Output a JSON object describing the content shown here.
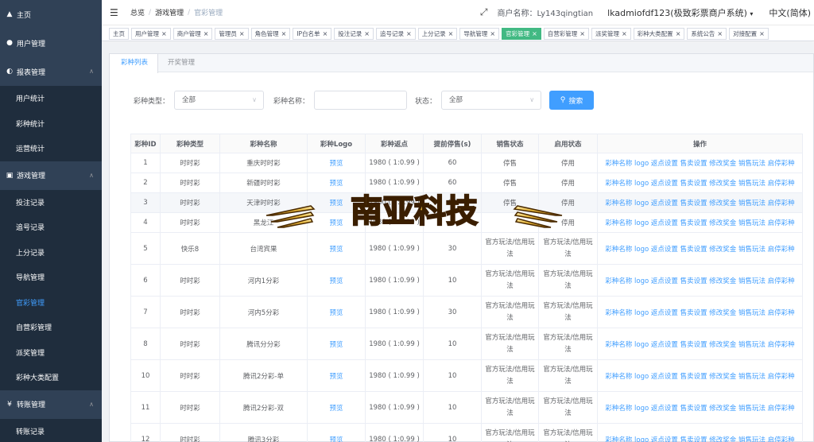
{
  "sidebar": {
    "groups": [
      {
        "label": "主页",
        "icon": "dashboard-icon",
        "glyph": "▲",
        "sub": []
      },
      {
        "label": "用户管理",
        "icon": "user-icon",
        "glyph": "●",
        "sub": []
      },
      {
        "label": "报表管理",
        "icon": "chart-icon",
        "glyph": "◐",
        "sub": [
          "用户统计",
          "彩种统计",
          "运营统计"
        ]
      },
      {
        "label": "游戏管理",
        "icon": "game-icon",
        "glyph": "▣",
        "sub": [
          "投注记录",
          "追号记录",
          "上分记录",
          "导航管理",
          "官彩管理",
          "自营彩管理",
          "派奖管理",
          "彩种大类配置"
        ]
      },
      {
        "label": "转账管理",
        "icon": "yen-icon",
        "glyph": "¥",
        "sub": [
          "转账记录"
        ]
      }
    ],
    "active_sub": "官彩管理"
  },
  "header": {
    "breadcrumb": [
      "总览",
      "游戏管理",
      "官彩管理"
    ],
    "merchant": "商户名称：Ly143qingtian",
    "account": "lkadmiofdf123(极致彩票商户系统)",
    "language": "中文(简体)"
  },
  "tags": [
    {
      "label": "主页",
      "closable": false,
      "active": false
    },
    {
      "label": "用户管理",
      "closable": true,
      "active": false
    },
    {
      "label": "商户管理",
      "closable": true,
      "active": false
    },
    {
      "label": "管理员",
      "closable": true,
      "active": false
    },
    {
      "label": "角色管理",
      "closable": true,
      "active": false
    },
    {
      "label": "IP白名单",
      "closable": true,
      "active": false
    },
    {
      "label": "投注记录",
      "closable": true,
      "active": false
    },
    {
      "label": "追号记录",
      "closable": true,
      "active": false
    },
    {
      "label": "上分记录",
      "closable": true,
      "active": false
    },
    {
      "label": "导航管理",
      "closable": true,
      "active": false
    },
    {
      "label": "官彩管理",
      "closable": true,
      "active": true
    },
    {
      "label": "自营彩管理",
      "closable": true,
      "active": false
    },
    {
      "label": "派奖管理",
      "closable": true,
      "active": false
    },
    {
      "label": "彩种大类配置",
      "closable": true,
      "active": false
    },
    {
      "label": "系统公告",
      "closable": true,
      "active": false
    },
    {
      "label": "对接配置",
      "closable": true,
      "active": false
    }
  ],
  "tabs": [
    "彩种列表",
    "开奖管理"
  ],
  "filters": {
    "type_label": "彩种类型：",
    "type_value": "全部",
    "name_label": "彩种名称：",
    "name_value": "",
    "status_label": "状态：",
    "status_value": "全部",
    "search_label": "搜索"
  },
  "table": {
    "columns": [
      "彩种ID",
      "彩种类型",
      "彩种名称",
      "彩种Logo",
      "彩种返点",
      "提前停售(s)",
      "销售状态",
      "启用状态",
      "操作"
    ],
    "actions": "彩种名称 logo 返点设置 售卖设置 修改奖金 销售玩法 启停彩种",
    "logo_link": "预览",
    "rows": [
      {
        "id": "1",
        "type": "时时彩",
        "name": "重庆时时彩",
        "rebate": "1980 ( 1:0.99 )",
        "stop": "60",
        "sale": "停售",
        "enable": "停用"
      },
      {
        "id": "2",
        "type": "时时彩",
        "name": "新疆时时彩",
        "rebate": "1980 ( 1:0.99 )",
        "stop": "60",
        "sale": "停售",
        "enable": "停用"
      },
      {
        "id": "3",
        "type": "时时彩",
        "name": "天津时时彩",
        "rebate": "1980 ( 1:0.99 )",
        "stop": "60",
        "sale": "停售",
        "enable": "停用"
      },
      {
        "id": "4",
        "type": "时时彩",
        "name": "黑龙江",
        "rebate": "1980 ( 1:0.99 )",
        "stop": "",
        "sale": "",
        "enable": "停用"
      },
      {
        "id": "5",
        "type": "快乐8",
        "name": "台湾宾果",
        "rebate": "1980 ( 1:0.99 )",
        "stop": "30",
        "sale": "官方玩法/信用玩法",
        "enable": "官方玩法/信用玩法"
      },
      {
        "id": "6",
        "type": "时时彩",
        "name": "河内1分彩",
        "rebate": "1980 ( 1:0.99 )",
        "stop": "10",
        "sale": "官方玩法/信用玩法",
        "enable": "官方玩法/信用玩法"
      },
      {
        "id": "7",
        "type": "时时彩",
        "name": "河内5分彩",
        "rebate": "1980 ( 1:0.99 )",
        "stop": "30",
        "sale": "官方玩法/信用玩法",
        "enable": "官方玩法/信用玩法"
      },
      {
        "id": "8",
        "type": "时时彩",
        "name": "腾讯分分彩",
        "rebate": "1980 ( 1:0.99 )",
        "stop": "10",
        "sale": "官方玩法/信用玩法",
        "enable": "官方玩法/信用玩法"
      },
      {
        "id": "10",
        "type": "时时彩",
        "name": "腾讯2分彩-单",
        "rebate": "1980 ( 1:0.99 )",
        "stop": "10",
        "sale": "官方玩法/信用玩法",
        "enable": "官方玩法/信用玩法"
      },
      {
        "id": "11",
        "type": "时时彩",
        "name": "腾讯2分彩-双",
        "rebate": "1980 ( 1:0.99 )",
        "stop": "10",
        "sale": "官方玩法/信用玩法",
        "enable": "官方玩法/信用玩法"
      },
      {
        "id": "12",
        "type": "时时彩",
        "name": "腾讯3分彩",
        "rebate": "1980 ( 1:0.99 )",
        "stop": "10",
        "sale": "官方玩法/信用玩法",
        "enable": "官方玩法/信用玩法"
      }
    ]
  },
  "watermark": "南亚科技",
  "colors": {
    "primary": "#409eff",
    "active_tag": "#42b983",
    "sidebar_bg": "#1f2d3d",
    "sidebar_group_bg": "#304156"
  }
}
